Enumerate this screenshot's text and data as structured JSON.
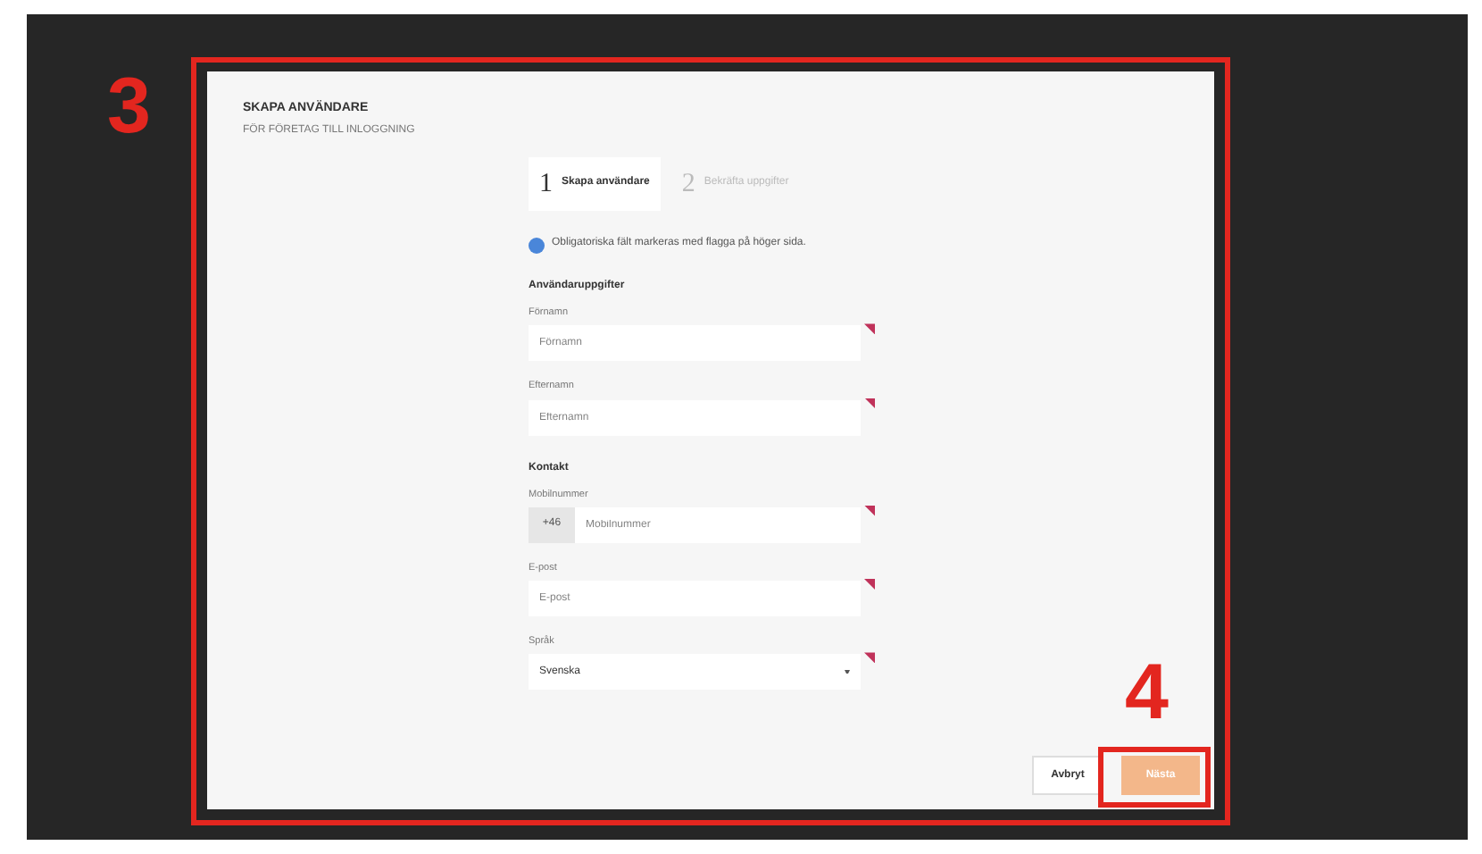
{
  "dialog": {
    "title": "SKAPA ANVÄNDARE",
    "subtitle": "FÖR FÖRETAG TILL INLOGGNING",
    "steps": [
      {
        "number": "1",
        "label": "Skapa användare",
        "selected": true
      },
      {
        "number": "2",
        "label": "Bekräfta uppgifter",
        "selected": false
      }
    ],
    "info": "Obligatoriska fält markeras med flagga på höger sida.",
    "sections": [
      {
        "title": "Användaruppgifter",
        "fields": [
          {
            "kind": "text",
            "label": "Förnamn",
            "placeholder": "Förnamn",
            "required": true
          },
          {
            "kind": "text",
            "label": "Efternamn",
            "placeholder": "Efternamn",
            "required": true
          }
        ]
      },
      {
        "title": "Kontakt",
        "fields": [
          {
            "kind": "phone",
            "label": "Mobilnummer",
            "prefix": "+46",
            "placeholder": "Mobilnummer",
            "required": true
          },
          {
            "kind": "text",
            "label": "E-post",
            "placeholder": "E-post",
            "required": true
          },
          {
            "kind": "select",
            "label": "Språk",
            "value": "Svenska",
            "required": true
          }
        ]
      }
    ],
    "buttons": [
      {
        "label": "Avbryt",
        "kind": "secondary"
      },
      {
        "label": "Nästa",
        "kind": "primary"
      }
    ]
  },
  "annotations": [
    {
      "label": "3",
      "kind": "large"
    },
    {
      "label": "4",
      "kind": "small"
    }
  ]
}
